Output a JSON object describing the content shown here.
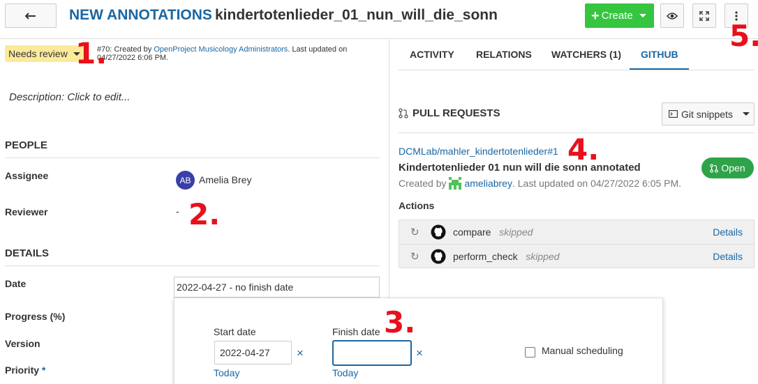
{
  "header": {
    "type": "New annotations",
    "subject": "kindertotenlieder_01_nun_will_die_sonn",
    "create_label": "Create"
  },
  "status": {
    "label": "Needs review"
  },
  "meta": {
    "prefix": "#70: Created by ",
    "author": "OpenProject Musicology Administrators",
    "suffix": ". Last updated on 04/27/2022 6:06 PM."
  },
  "description": {
    "placeholder": "Description: Click to edit..."
  },
  "people": {
    "title": "People",
    "assignee_label": "Assignee",
    "assignee_initials": "AB",
    "assignee_name": "Amelia Brey",
    "reviewer_label": "Reviewer",
    "reviewer_value": "-"
  },
  "details": {
    "title": "Details",
    "date_label": "Date",
    "date_value": "2022-04-27 - no finish date",
    "progress_label": "Progress (%)",
    "version_label": "Version",
    "priority_label": "Priority",
    "required_mark": "*"
  },
  "datepicker": {
    "start_label": "Start date",
    "start_value": "2022-04-27",
    "finish_label": "Finish date",
    "finish_value": "",
    "clear_glyph": "×",
    "today_label": "Today",
    "manual_label": "Manual scheduling"
  },
  "tabs": [
    {
      "label": "Activity"
    },
    {
      "label": "Relations"
    },
    {
      "label": "Watchers (1)"
    },
    {
      "label": "GitHub"
    }
  ],
  "active_tab": "GitHub",
  "github": {
    "heading": "Pull requests",
    "snippets_label": "Git snippets",
    "pr_link": "DCMLab/mahler_kindertotenlieder#1",
    "pr_title": "Kindertotenlieder 01 nun will die sonn annotated",
    "created_by": "Created by",
    "author": "ameliabrey",
    "updated": ". Last updated on 04/27/2022 6:05 PM.",
    "state": "Open",
    "actions_label": "Actions",
    "actions": [
      {
        "name": "compare",
        "status": "skipped",
        "details": "Details"
      },
      {
        "name": "perform_check",
        "status": "skipped",
        "details": "Details"
      }
    ]
  },
  "markers": [
    "1.",
    "2.",
    "3.",
    "4.",
    "5."
  ],
  "colors": {
    "link_blue": "#1a67a3",
    "create_green": "#35c53f",
    "open_green": "#2ea34a",
    "status_yellow": "#fcea9a",
    "marker_red": "#e8101b"
  },
  "icons": [
    "arrow-left-icon",
    "plus-icon",
    "eye-icon",
    "fullscreen-icon",
    "more-vertical-icon",
    "pull-request-icon",
    "code-icon",
    "refresh-icon",
    "github-icon",
    "user-identicon"
  ]
}
